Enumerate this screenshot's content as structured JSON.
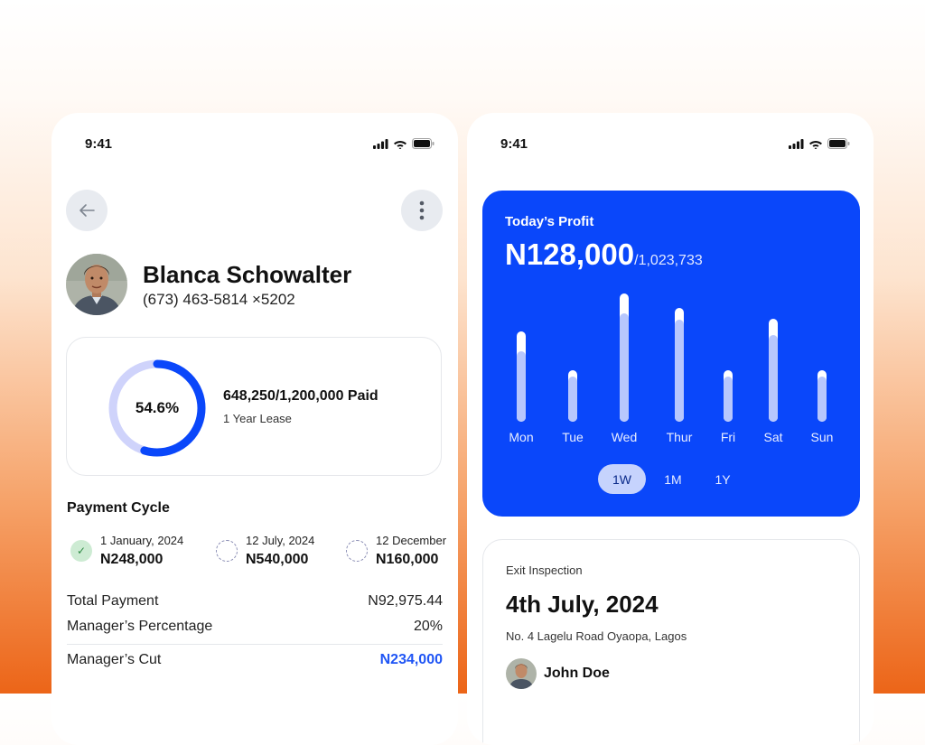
{
  "colors": {
    "accent": "#0a47fa",
    "success": "#2f8a45",
    "link_blue": "#1f55f5"
  },
  "left_phone": {
    "status_time": "9:41",
    "icons": {
      "back": "arrow-left-icon",
      "more": "more-vertical-icon",
      "signal": "signal-icon",
      "wifi": "wifi-icon",
      "battery": "battery-icon"
    },
    "profile": {
      "name": "Blanca Schowalter",
      "phone": "(673) 463-5814 ×5202"
    },
    "lease": {
      "progress_percent": 54.6,
      "progress_label": "54.6%",
      "paid": "648,250/1,200,000 Paid",
      "term": "1 Year Lease"
    },
    "payment_cycle": {
      "title": "Payment Cycle",
      "items": [
        {
          "date": "1 January, 2024",
          "amount": "N248,000",
          "status": "paid"
        },
        {
          "date": "12 July, 2024",
          "amount": "N540,000",
          "status": "pending"
        },
        {
          "date": "12 December",
          "amount": "N160,000",
          "status": "pending"
        }
      ]
    },
    "summary": {
      "total_payment_label": "Total Payment",
      "total_payment_value": "N92,975.44",
      "percentage_label": "Manager’s Percentage",
      "percentage_value": "20%",
      "cut_label": "Manager’s Cut",
      "cut_value": "N234,000"
    }
  },
  "right_phone": {
    "status_time": "9:41",
    "profit": {
      "title": "Today’s Profit",
      "amount": "N128,000",
      "total": "/1,023,733",
      "ranges": [
        "1W",
        "1M",
        "1Y"
      ],
      "active_range": "1W"
    },
    "chart_data": {
      "type": "bar",
      "categories": [
        "Mon",
        "Tue",
        "Wed",
        "Thur",
        "Fri",
        "Sat",
        "Sun"
      ],
      "series": [
        {
          "values": [
            100,
            57,
            142,
            126,
            57,
            114,
            57
          ]
        },
        {
          "values": [
            78,
            50,
            120,
            113,
            50,
            96,
            50
          ]
        }
      ]
    },
    "inspection": {
      "label": "Exit Inspection",
      "date": "4th July, 2024",
      "address": "No. 4 Lagelu Road Oyaopa, Lagos",
      "person": "John Doe"
    }
  }
}
